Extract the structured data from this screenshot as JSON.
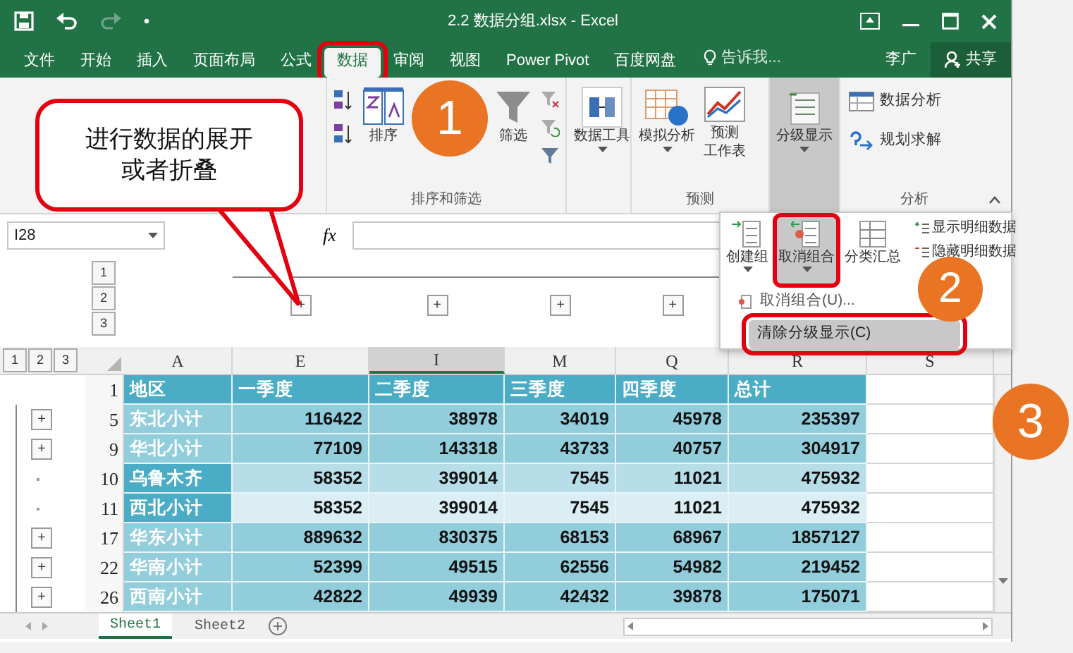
{
  "window": {
    "title": "2.2 数据分组.xlsx - Excel"
  },
  "ribbon_tabs": [
    {
      "label": "文件",
      "selected": false,
      "highlighted": false
    },
    {
      "label": "开始",
      "selected": false,
      "highlighted": false
    },
    {
      "label": "插入",
      "selected": false,
      "highlighted": false
    },
    {
      "label": "页面布局",
      "selected": false,
      "highlighted": false
    },
    {
      "label": "公式",
      "selected": false,
      "highlighted": false
    },
    {
      "label": "数据",
      "selected": true,
      "highlighted": true
    },
    {
      "label": "审阅",
      "selected": false,
      "highlighted": false
    },
    {
      "label": "视图",
      "selected": false,
      "highlighted": false
    },
    {
      "label": "Power Pivot",
      "selected": false,
      "highlighted": false
    },
    {
      "label": "百度网盘",
      "selected": false,
      "highlighted": false
    }
  ],
  "tell_me": {
    "placeholder": "告诉我..."
  },
  "user": {
    "name": "李广"
  },
  "share_button": "共享",
  "ribbon": {
    "sort_filter": {
      "sort": "排序",
      "filter": "筛选",
      "label": "排序和筛选"
    },
    "data_tools": "数据工具",
    "forecast": {
      "what_if": "模拟分析",
      "forecast_sheet": [
        "预测",
        "工作表"
      ],
      "label": "预测"
    },
    "outline": {
      "label": "分级显示",
      "pressed": true
    },
    "analysis": {
      "items": [
        "数据分析",
        "规划求解"
      ],
      "label": "分析"
    }
  },
  "formula_bar": {
    "name_box": "I28",
    "fx": "fx"
  },
  "outline_menu": {
    "buttons": [
      {
        "label": "创建组",
        "highlighted": false
      },
      {
        "label": "取消组合",
        "highlighted": true
      },
      {
        "label": "分类汇总",
        "highlighted": false
      }
    ],
    "detail_items": [
      "显示明细数据",
      "隐藏明细数据"
    ],
    "items": [
      {
        "label": "取消组合(U)...",
        "selected": false,
        "highlighted": false
      },
      {
        "label": "清除分级显示(C)",
        "selected": true,
        "highlighted": true
      }
    ]
  },
  "callout": {
    "lines": [
      "进行数据的展开",
      "或者折叠"
    ]
  },
  "steps": [
    "1",
    "2",
    "3"
  ],
  "sheet": {
    "column_levels": [
      "1",
      "2",
      "3"
    ],
    "row_levels": [
      "1",
      "2",
      "3"
    ],
    "column_group_buttons": [
      "+",
      "+",
      "+",
      "+"
    ],
    "columns": [
      {
        "label": "A",
        "selected": false
      },
      {
        "label": "E",
        "selected": false
      },
      {
        "label": "I",
        "selected": true
      },
      {
        "label": "M",
        "selected": false
      },
      {
        "label": "Q",
        "selected": false
      },
      {
        "label": "R",
        "selected": false
      },
      {
        "label": "S",
        "selected": false
      }
    ],
    "header": {
      "number": "1",
      "cells": [
        "地区",
        "一季度",
        "二季度",
        "三季度",
        "四季度",
        "总计"
      ]
    },
    "rows": [
      {
        "number": "5",
        "detail": false,
        "outline_button": "+",
        "cells": [
          "东北小计",
          "116422",
          "38978",
          "34019",
          "45978",
          "235397"
        ]
      },
      {
        "number": "9",
        "detail": false,
        "outline_button": "+",
        "cells": [
          "华北小计",
          "77109",
          "143318",
          "43733",
          "40757",
          "304917"
        ]
      },
      {
        "number": "10",
        "detail": true,
        "cells": [
          "乌鲁木齐",
          "58352",
          "399014",
          "7545",
          "11021",
          "475932"
        ]
      },
      {
        "number": "11",
        "detail": true,
        "cells": [
          "西北小计",
          "58352",
          "399014",
          "7545",
          "11021",
          "475932"
        ]
      },
      {
        "number": "17",
        "detail": false,
        "outline_button": "+",
        "cells": [
          "华东小计",
          "889632",
          "830375",
          "68153",
          "68967",
          "1857127"
        ]
      },
      {
        "number": "22",
        "detail": false,
        "outline_button": "+",
        "cells": [
          "华南小计",
          "52399",
          "49515",
          "62556",
          "54982",
          "219452"
        ]
      },
      {
        "number": "26",
        "detail": false,
        "outline_button": "+",
        "cells": [
          "西南小计",
          "42822",
          "49939",
          "42432",
          "39878",
          "175071"
        ]
      }
    ]
  },
  "sheet_tabs": [
    {
      "label": "Sheet1",
      "selected": true
    },
    {
      "label": "Sheet2",
      "selected": false
    }
  ]
}
